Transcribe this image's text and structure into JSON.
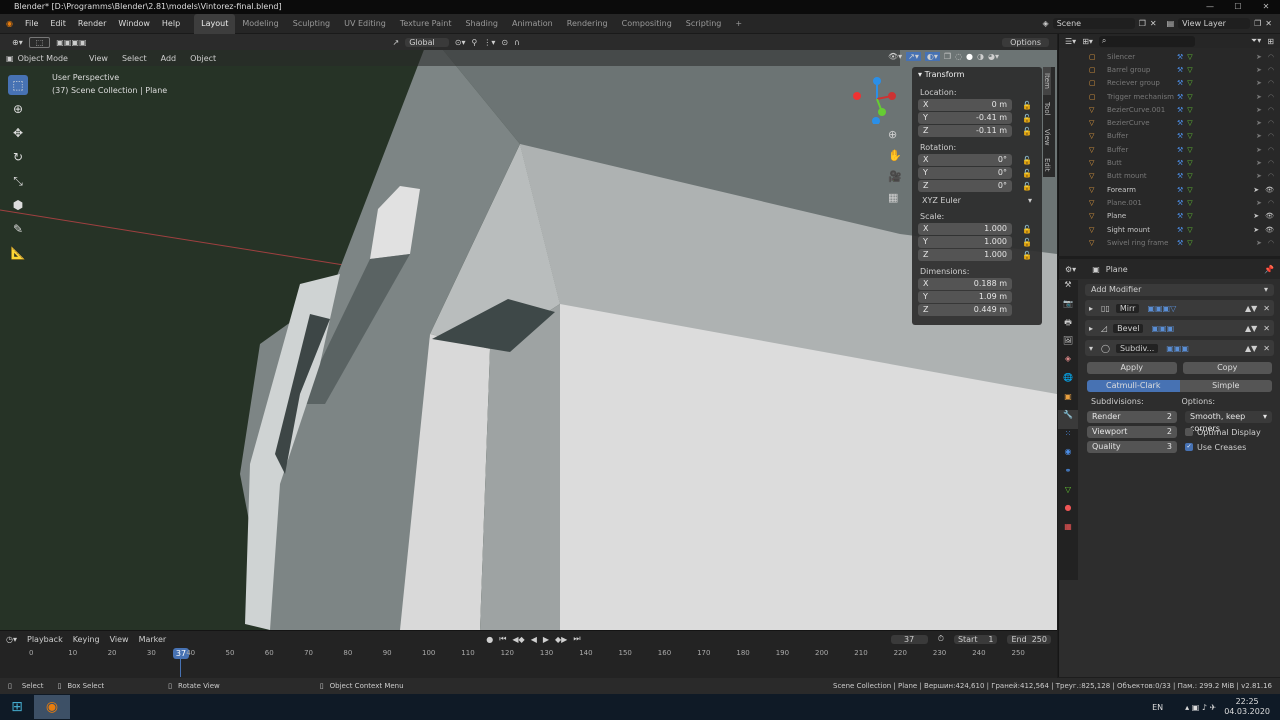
{
  "window": {
    "title": "Blender* [D:\\Programms\\Blender\\2.81\\models\\Vintorez-final.blend]"
  },
  "menu": [
    "File",
    "Edit",
    "Render",
    "Window",
    "Help"
  ],
  "workspaces": {
    "active": "Layout",
    "items": [
      "Modeling",
      "Sculpting",
      "UV Editing",
      "Texture Paint",
      "Shading",
      "Animation",
      "Rendering",
      "Compositing",
      "Scripting"
    ],
    "add": "+"
  },
  "scene": {
    "label": "Scene",
    "view_layer": "View Layer"
  },
  "toolbar": {
    "transform_orientation": "Global",
    "options": "Options"
  },
  "viewport_header": {
    "mode": "Object Mode",
    "menus": [
      "View",
      "Select",
      "Add",
      "Object"
    ]
  },
  "viewport_overlay": {
    "perspective": "User Perspective",
    "collection": "(37) Scene Collection | Plane"
  },
  "npanel": {
    "title": "Transform",
    "location_label": "Location:",
    "location": [
      {
        "axis": "X",
        "value": "0 m"
      },
      {
        "axis": "Y",
        "value": "-0.41 m"
      },
      {
        "axis": "Z",
        "value": "-0.11 m"
      }
    ],
    "rotation_label": "Rotation:",
    "rotation": [
      {
        "axis": "X",
        "value": "0°"
      },
      {
        "axis": "Y",
        "value": "0°"
      },
      {
        "axis": "Z",
        "value": "0°"
      }
    ],
    "rotation_mode": "XYZ Euler",
    "scale_label": "Scale:",
    "scale": [
      {
        "axis": "X",
        "value": "1.000"
      },
      {
        "axis": "Y",
        "value": "1.000"
      },
      {
        "axis": "Z",
        "value": "1.000"
      }
    ],
    "dimensions_label": "Dimensions:",
    "dimensions": [
      {
        "axis": "X",
        "value": "0.188 m"
      },
      {
        "axis": "Y",
        "value": "1.09 m"
      },
      {
        "axis": "Z",
        "value": "0.449 m"
      }
    ],
    "tabs": [
      "Item",
      "Tool",
      "View",
      "Edit"
    ]
  },
  "outliner": {
    "items": [
      {
        "name": "Silencer",
        "dim": true
      },
      {
        "name": "Barrel group",
        "dim": true
      },
      {
        "name": "Reciever group",
        "dim": true
      },
      {
        "name": "Trigger mechanism",
        "dim": true
      },
      {
        "name": "BezierCurve.001",
        "dim": true
      },
      {
        "name": "BezierCurve",
        "dim": true
      },
      {
        "name": "Buffer",
        "dim": true
      },
      {
        "name": "Buffer",
        "dim": true
      },
      {
        "name": "Butt",
        "dim": true
      },
      {
        "name": "Butt mount",
        "dim": true
      },
      {
        "name": "Forearm",
        "dim": false
      },
      {
        "name": "Plane.001",
        "dim": true
      },
      {
        "name": "Plane",
        "dim": false
      },
      {
        "name": "Sight mount",
        "dim": false
      },
      {
        "name": "Swivel ring frame",
        "dim": true
      }
    ]
  },
  "properties": {
    "object": "Plane",
    "add_modifier": "Add Modifier",
    "modifiers": [
      "Mirr",
      "Bevel",
      "Subdiv..."
    ],
    "apply": "Apply",
    "copy": "Copy",
    "catmull": "Catmull-Clark",
    "simple": "Simple",
    "subdivisions_label": "Subdivisions:",
    "options_label": "Options:",
    "render_label": "Render",
    "render_val": "2",
    "viewport_label": "Viewport",
    "viewport_val": "2",
    "quality_label": "Quality",
    "quality_val": "3",
    "uv_smooth": "Smooth, keep corners",
    "optimal": "Optimal Display",
    "creases": "Use Creases"
  },
  "timeline": {
    "menus": [
      "Playback",
      "Keying",
      "View",
      "Marker"
    ],
    "current": "37",
    "start_label": "Start",
    "start": "1",
    "end_label": "End",
    "end": "250",
    "ticks": [
      "0",
      "10",
      "20",
      "30",
      "40",
      "50",
      "60",
      "70",
      "80",
      "90",
      "100",
      "110",
      "120",
      "130",
      "140",
      "150",
      "160",
      "170",
      "180",
      "190",
      "200",
      "210",
      "220",
      "230",
      "240",
      "250"
    ],
    "frame_badge": "37"
  },
  "status": {
    "select": "Select",
    "box": "Box Select",
    "rotate": "Rotate View",
    "context": "Object Context Menu",
    "info": "Scene Collection | Plane | Вершин:424,610 | Граней:412,564 | Треуг.:825,128 | Объектов:0/33 | Пам.: 299.2 MiB | v2.81.16"
  },
  "taskbar": {
    "lang": "EN",
    "time": "22:25",
    "date": "04.03.2020"
  }
}
